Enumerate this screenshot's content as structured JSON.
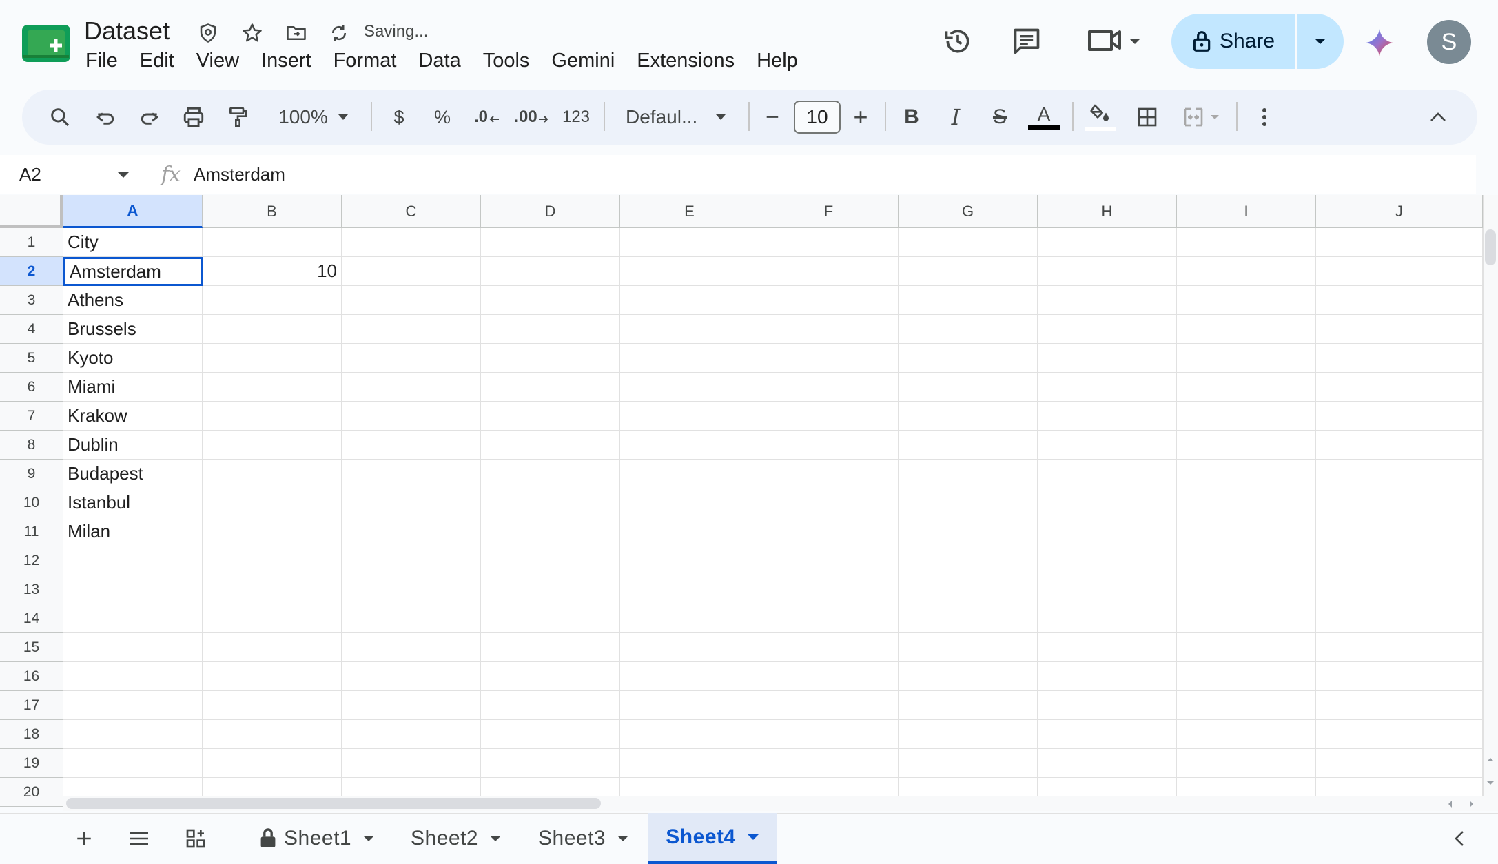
{
  "app": {
    "doc_title": "Dataset",
    "status": "Saving...",
    "menu": [
      "File",
      "Edit",
      "View",
      "Insert",
      "Format",
      "Data",
      "Tools",
      "Gemini",
      "Extensions",
      "Help"
    ],
    "share_label": "Share",
    "avatar_letter": "S",
    "brand_color": "#0b57d0",
    "sheets_green": "#0f9d58"
  },
  "toolbar": {
    "zoom": "100%",
    "currency": "$",
    "percent": "%",
    "decrease_decimals": ".0",
    "increase_decimals": ".00",
    "number_format": "123",
    "font": "Defaul...",
    "font_size": "10",
    "minus": "−",
    "plus": "+",
    "bold": "B",
    "italic": "I",
    "strike": "S",
    "text_color": "A"
  },
  "formula_bar": {
    "name_box": "A2",
    "fx": "fx",
    "value": "Amsterdam"
  },
  "grid": {
    "columns": [
      "A",
      "B",
      "C",
      "D",
      "E",
      "F",
      "G",
      "H",
      "I",
      "J"
    ],
    "rows": [
      "1",
      "2",
      "3",
      "4",
      "5",
      "6",
      "7",
      "8",
      "9",
      "10",
      "11",
      "12",
      "13",
      "14",
      "15",
      "16",
      "17",
      "18",
      "19",
      "20"
    ],
    "selected_column": "A",
    "selected_row": "2",
    "cells": {
      "A1": "City",
      "A2": "Amsterdam",
      "B2": "10",
      "A3": "Athens",
      "A4": "Brussels",
      "A5": "Kyoto",
      "A6": "Miami",
      "A7": "Krakow",
      "A8": "Dublin",
      "A9": "Budapest",
      "A10": "Istanbul",
      "A11": "Milan"
    }
  },
  "sheets": {
    "tabs": [
      "Sheet1",
      "Sheet2",
      "Sheet3",
      "Sheet4"
    ],
    "active": "Sheet4"
  }
}
